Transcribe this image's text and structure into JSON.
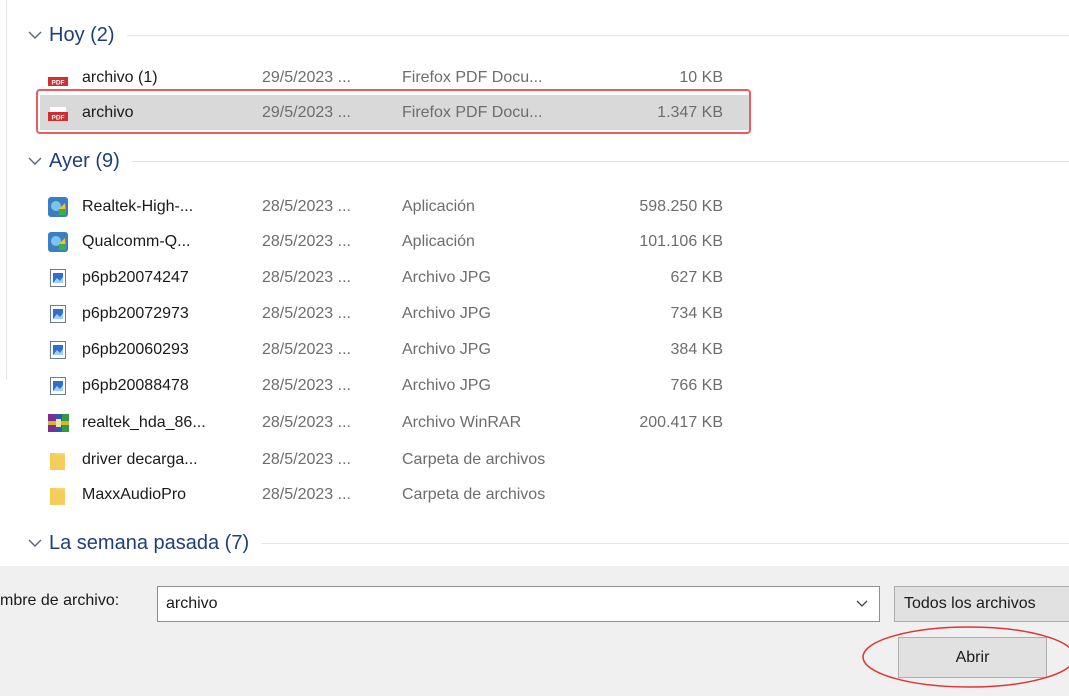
{
  "groups": [
    {
      "title": "Hoy (2)",
      "files": [
        {
          "icon": "pdf-icon",
          "name": "archivo (1)",
          "date": "29/5/2023 ...",
          "type": "Firefox PDF Docu...",
          "size": "10 KB"
        },
        {
          "icon": "pdf-icon",
          "name": "archivo",
          "date": "29/5/2023 ...",
          "type": "Firefox PDF Docu...",
          "size": "1.347 KB",
          "selected": true
        }
      ]
    },
    {
      "title": "Ayer (9)",
      "files": [
        {
          "icon": "installer-icon",
          "name": "Realtek-High-...",
          "date": "28/5/2023 ...",
          "type": "Aplicación",
          "size": "598.250 KB"
        },
        {
          "icon": "installer-icon",
          "name": "Qualcomm-Q...",
          "date": "28/5/2023 ...",
          "type": "Aplicación",
          "size": "101.106 KB"
        },
        {
          "icon": "image-icon",
          "name": "p6pb20074247",
          "date": "28/5/2023 ...",
          "type": "Archivo JPG",
          "size": "627 KB"
        },
        {
          "icon": "image-icon",
          "name": "p6pb20072973",
          "date": "28/5/2023 ...",
          "type": "Archivo JPG",
          "size": "734 KB"
        },
        {
          "icon": "image-icon",
          "name": "p6pb20060293",
          "date": "28/5/2023 ...",
          "type": "Archivo JPG",
          "size": "384 KB"
        },
        {
          "icon": "image-icon",
          "name": "p6pb20088478",
          "date": "28/5/2023 ...",
          "type": "Archivo JPG",
          "size": "766 KB"
        },
        {
          "icon": "winrar-icon",
          "name": "realtek_hda_86...",
          "date": "28/5/2023 ...",
          "type": "Archivo WinRAR",
          "size": "200.417 KB"
        },
        {
          "icon": "folder-icon",
          "name": "driver decarga...",
          "date": "28/5/2023 ...",
          "type": "Carpeta de archivos",
          "size": ""
        },
        {
          "icon": "folder-icon",
          "name": "MaxxAudioPro",
          "date": "28/5/2023 ...",
          "type": "Carpeta de archivos",
          "size": ""
        }
      ]
    },
    {
      "title": "La semana pasada (7)",
      "files": []
    }
  ],
  "footer": {
    "filename_label": "mbre de archivo:",
    "filename_value": "archivo",
    "filter_label": "Todos los archivos",
    "open_label": "Abrir"
  },
  "colors": {
    "selection_outline": "#ec5c5c",
    "group_title": "#1f3f7a",
    "selected_row": "#d9d9d9"
  }
}
